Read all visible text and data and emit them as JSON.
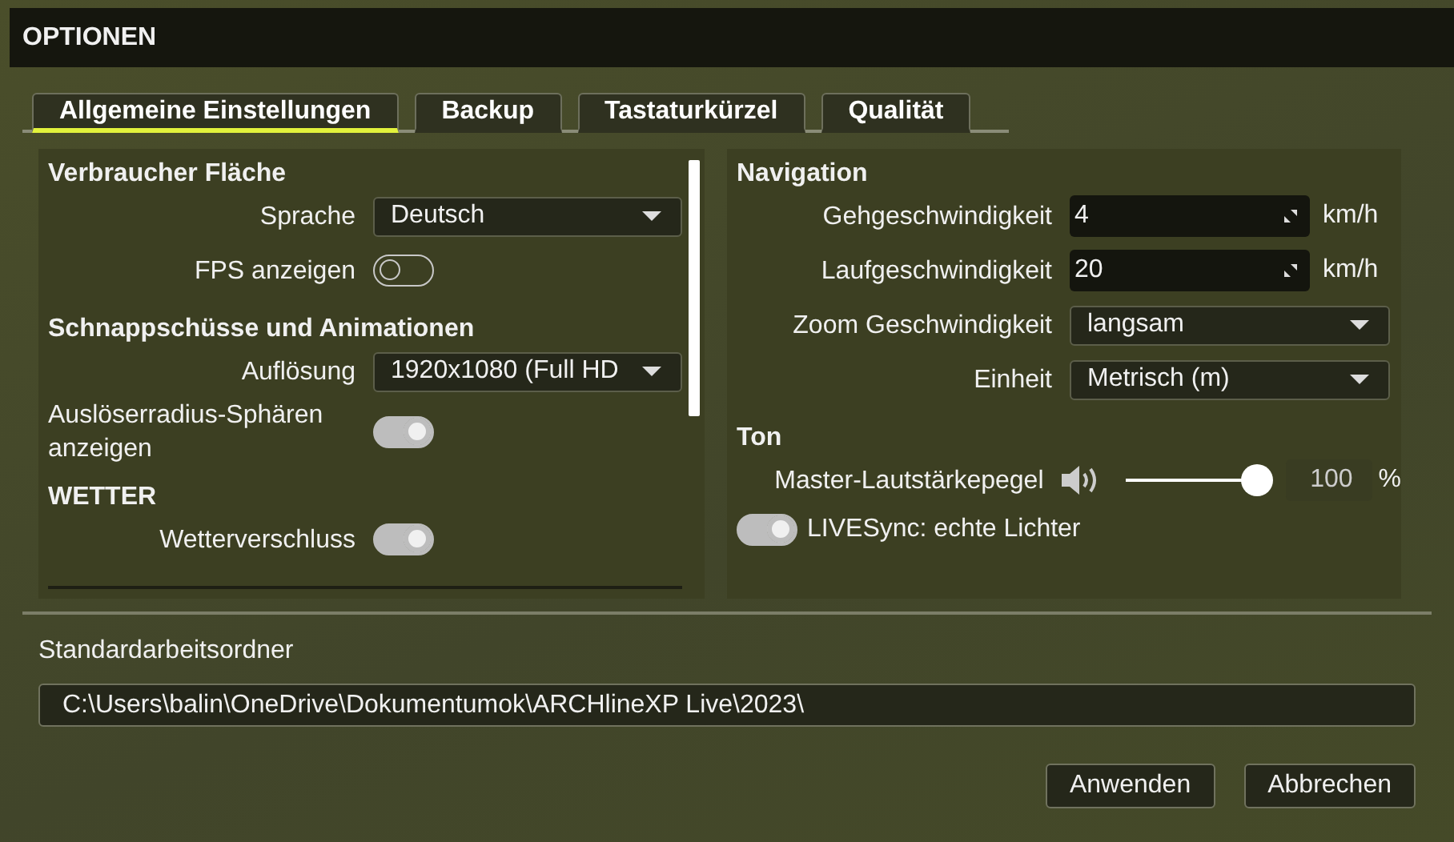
{
  "window": {
    "title": "OPTIONEN"
  },
  "tabs": [
    {
      "label": "Allgemeine Einstellungen",
      "selected": true
    },
    {
      "label": "Backup",
      "selected": false
    },
    {
      "label": "Tastaturkürzel",
      "selected": false
    },
    {
      "label": "Qualität",
      "selected": false
    }
  ],
  "left_panel": {
    "sections": [
      {
        "title": "Verbraucher Fläche",
        "rows": [
          {
            "kind": "dropdown",
            "label": "Sprache",
            "value": "Deutsch"
          },
          {
            "kind": "toggle",
            "label": "FPS anzeigen",
            "on": false
          }
        ]
      },
      {
        "title": "Schnappschüsse und Animationen",
        "rows": [
          {
            "kind": "dropdown",
            "label": "Auflösung",
            "value": "1920x1080 (Full HD"
          },
          {
            "kind": "toggle",
            "label": "Auslöserradius-Sphären anzeigen",
            "on": true
          }
        ]
      },
      {
        "title": "WETTER",
        "rows": [
          {
            "kind": "toggle",
            "label": "Wetterverschluss",
            "on": true
          }
        ]
      }
    ]
  },
  "right_panel": {
    "sections": [
      {
        "title": "Navigation",
        "rows": [
          {
            "kind": "number",
            "label": "Gehgeschwindigkeit",
            "value": "4",
            "unit": "km/h"
          },
          {
            "kind": "number",
            "label": "Laufgeschwindigkeit",
            "value": "20",
            "unit": "km/h"
          },
          {
            "kind": "dropdown",
            "label": "Zoom Geschwindigkeit",
            "value": "langsam"
          },
          {
            "kind": "dropdown",
            "label": "Einheit",
            "value": "Metrisch (m)"
          }
        ]
      },
      {
        "title": "Ton",
        "rows": [
          {
            "kind": "slider",
            "label": "Master-Lautstärkepegel",
            "level": 1,
            "reading": "100",
            "unit": "%"
          },
          {
            "kind": "toggle_left",
            "label": "LIVESync: echte Lichter",
            "on": true
          }
        ]
      }
    ]
  },
  "folder": {
    "label": "Standardarbeitsordner",
    "value": "C:\\Users\\balin\\OneDrive\\Dokumentumok\\ARCHlineXP Live\\2023\\"
  },
  "buttons": [
    "Anwenden",
    "Abbrechen"
  ]
}
